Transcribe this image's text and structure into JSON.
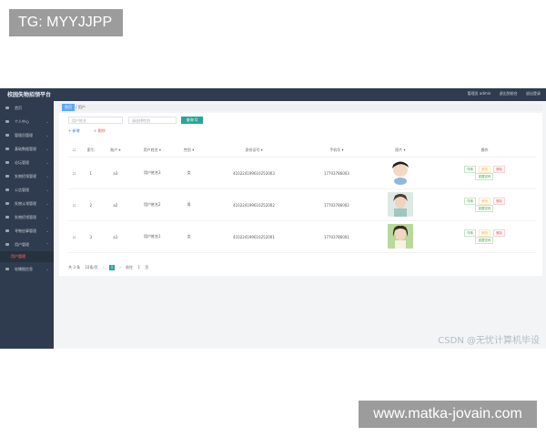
{
  "overlay": {
    "tg_label": "TG: MYYJJPP",
    "url_label": "www.matka-jovain.com"
  },
  "topbar": {
    "title": "校园失物招领平台",
    "links": [
      "管理员 admin",
      "退出到前台",
      "退出登录"
    ]
  },
  "sidebar": {
    "items": [
      {
        "label": "首页"
      },
      {
        "label": "个人中心"
      },
      {
        "label": "管理员管理"
      },
      {
        "label": "基础数据管理"
      },
      {
        "label": "论坛管理"
      },
      {
        "label": "失物招领管理"
      },
      {
        "label": "公告管理"
      },
      {
        "label": "失物认领管理"
      },
      {
        "label": "失物招领管理"
      },
      {
        "label": "寻物启事管理"
      },
      {
        "label": "用户管理"
      },
      {
        "label": "用户管理",
        "active": true
      },
      {
        "label": "轮播图信息"
      }
    ]
  },
  "breadcrumb": {
    "home": "首页",
    "current": "用户"
  },
  "search": {
    "placeholder": "用户姓名",
    "select_placeholder": "请选择性别",
    "query_label": "查询 Q"
  },
  "actions": {
    "add": "+ 新增",
    "delete": "× 删除"
  },
  "table": {
    "headers": [
      "索引",
      "账户 ▾",
      "用户姓名 ▾",
      "性别 ▾",
      "身份证号 ▾",
      "手机号 ▾",
      "照片 ▾",
      "操作"
    ],
    "rows": [
      {
        "index": "1",
        "account": "a3",
        "name": "用户姓名3",
        "gender": "女",
        "idcard": "410224199610252003",
        "phone": "17703786003"
      },
      {
        "index": "2",
        "account": "a2",
        "name": "用户姓名2",
        "gender": "男",
        "idcard": "410224199610252002",
        "phone": "17703786002"
      },
      {
        "index": "3",
        "account": "a1",
        "name": "用户姓名1",
        "gender": "女",
        "idcard": "410224199610252001",
        "phone": "17703786001"
      }
    ],
    "ops": {
      "view": "详情",
      "edit": "修改",
      "del": "删除",
      "reset": "重置密码"
    }
  },
  "pager": {
    "total": "共 3 条",
    "size": "10条/页",
    "page": "1",
    "goto": "前往",
    "goto_page": "1",
    "page_unit": "页"
  },
  "watermark": "CSDN @无忧计算机毕设",
  "colors": {
    "sidebar": "#2f3c4f",
    "accent": "#26a69a",
    "danger": "#e05a5a"
  }
}
